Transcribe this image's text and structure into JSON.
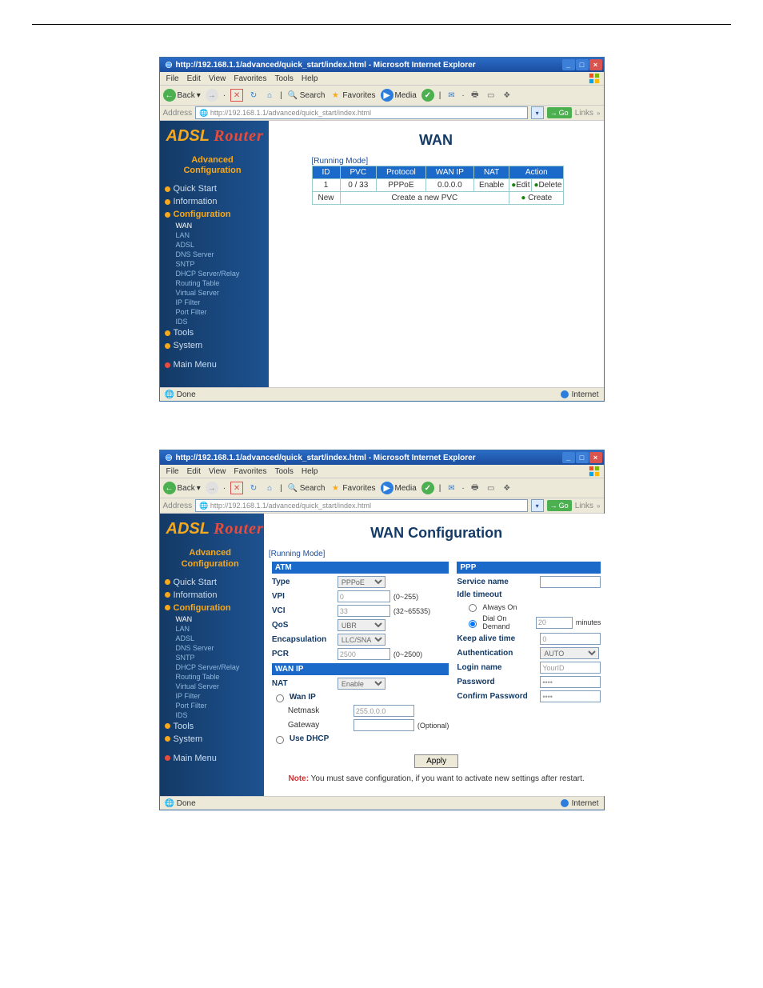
{
  "window": {
    "title": "http://192.168.1.1/advanced/quick_start/index.html - Microsoft Internet Explorer",
    "url": "http://192.168.1.1/advanced/quick_start/index.html",
    "go": "Go",
    "links": "Links",
    "address_label": "Address"
  },
  "menus": {
    "items": [
      "File",
      "Edit",
      "View",
      "Favorites",
      "Tools",
      "Help"
    ]
  },
  "toolbar": {
    "back": "Back",
    "search": "Search",
    "favorites": "Favorites",
    "media": "Media"
  },
  "logo": {
    "a": "ADSL",
    "r": "Router"
  },
  "adv_head": {
    "l1": "Advanced",
    "l2": "Configuration"
  },
  "nav": {
    "quick": "Quick Start",
    "info": "Information",
    "config": "Configuration",
    "sub": [
      "WAN",
      "LAN",
      "ADSL",
      "DNS Server",
      "SNTP",
      "DHCP Server/Relay",
      "Routing Table",
      "Virtual Server",
      "IP Filter",
      "Port Filter",
      "IDS"
    ],
    "tools": "Tools",
    "system": "System",
    "main": "Main Menu"
  },
  "wan_page": {
    "title": "WAN",
    "running": "[Running Mode]",
    "headers": [
      "ID",
      "PVC",
      "Protocol",
      "WAN IP",
      "NAT",
      "Action"
    ],
    "row": {
      "id": "1",
      "pvc": "0 / 33",
      "proto": "PPPoE",
      "ip": "0.0.0.0",
      "nat": "Enable",
      "edit": "Edit",
      "delete": "Delete"
    },
    "row2": {
      "id": "New",
      "create_text": "Create a new PVC",
      "create": "Create"
    }
  },
  "wanconf_page": {
    "title": "WAN Configuration",
    "running": "[Running Mode]",
    "atm": "ATM",
    "ppp": "PPP",
    "wanip": "WAN IP",
    "labels": {
      "type": "Type",
      "vpi": "VPI",
      "vci": "VCI",
      "qos": "QoS",
      "encap": "Encapsulation",
      "pcr": "PCR",
      "nat": "NAT",
      "wan_ip": "Wan IP",
      "netmask": "Netmask",
      "gateway": "Gateway",
      "usedhcp": "Use DHCP",
      "service": "Service name",
      "idle": "Idle timeout",
      "always": "Always On",
      "dod": "Dial On Demand",
      "keep": "Keep alive time",
      "auth": "Authentication",
      "login": "Login name",
      "pass": "Password",
      "cpass": "Confirm Password"
    },
    "values": {
      "type": "PPPoE",
      "vpi": "0",
      "vci": "33",
      "qos": "UBR",
      "encap": "LLC/SNAP",
      "pcr": "2500",
      "nat": "Enable",
      "netmask": "255.0.0.0",
      "dod": "20",
      "keep": "0",
      "auth": "AUTO",
      "login": "YourID",
      "pass": "••••",
      "cpass": "••••"
    },
    "hints": {
      "vpi": "(0~255)",
      "vci": "(32~65535)",
      "pcr": "(0~2500)",
      "gateway": "(Optional)",
      "dod_unit": "minutes"
    },
    "apply": "Apply",
    "note_b": "Note:",
    "note": " You must save configuration, if you want to activate new settings after restart."
  },
  "status": {
    "done": "Done",
    "internet": "Internet"
  }
}
